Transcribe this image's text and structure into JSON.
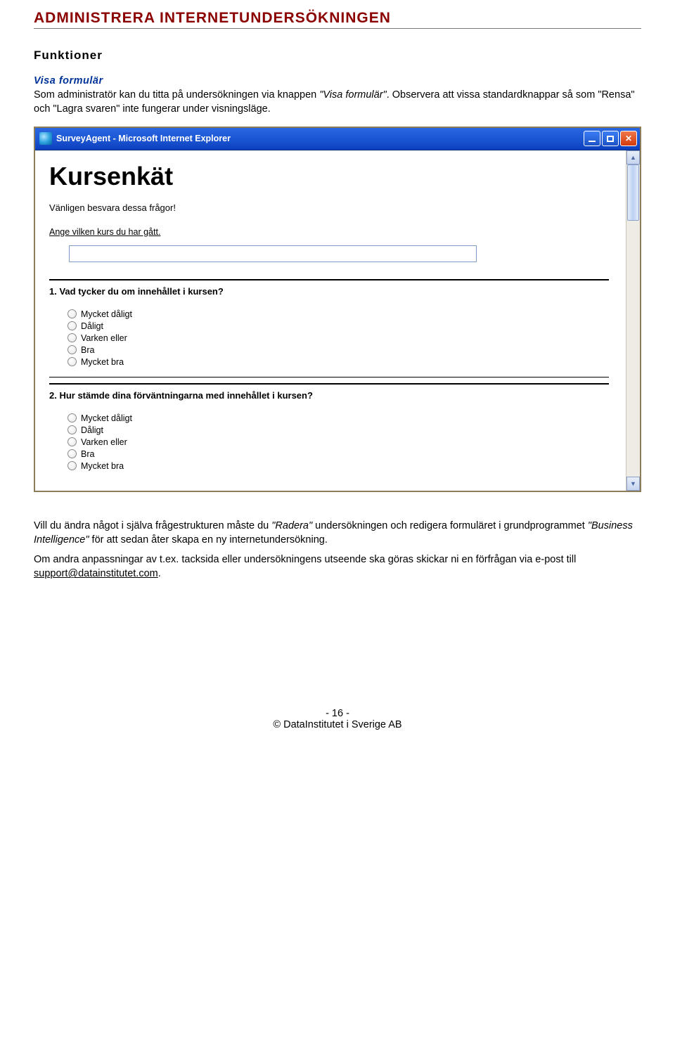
{
  "doc": {
    "h1": "ADMINISTRERA INTERNETUNDERSÖKNINGEN",
    "h2": "Funktioner",
    "h3": "Visa formulär",
    "p1_a": "Som administratör kan du titta på undersökningen via knappen ",
    "p1_i": "\"Visa formulär\"",
    "p1_b": ". Observera att vissa standardknappar så som \"Rensa\" och \"Lagra svaren\" inte fungerar under visningsläge.",
    "p2_a": "Vill du ändra något i själva frågestrukturen måste du ",
    "p2_i1": "\"Radera\"",
    "p2_b": " undersökningen och redigera formuläret i grundprogrammet ",
    "p2_i2": "\"Business Intelligence\"",
    "p2_c": " för att sedan åter skapa en ny internetundersökning.",
    "p3_a": "Om andra anpassningar av t.ex. tacksida eller undersökningens utseende ska göras skickar ni en förfrågan via e-post till ",
    "email": "support@datainstitutet.com",
    "p3_b": "."
  },
  "shot": {
    "title": "SurveyAgent - Microsoft Internet Explorer",
    "survey_title": "Kursenkät",
    "instruction": "Vänligen besvara dessa frågor!",
    "prompt1": "Ange vilken kurs du har gått.",
    "q1": "1. Vad tycker du om innehållet i kursen?",
    "q2": "2. Hur stämde dina förväntningarna med innehållet i kursen?",
    "opts": [
      "Mycket dåligt",
      "Dåligt",
      "Varken eller",
      "Bra",
      "Mycket bra"
    ]
  },
  "footer": {
    "page": "- 16 -",
    "copyright": "© DataInstitutet i Sverige AB"
  }
}
